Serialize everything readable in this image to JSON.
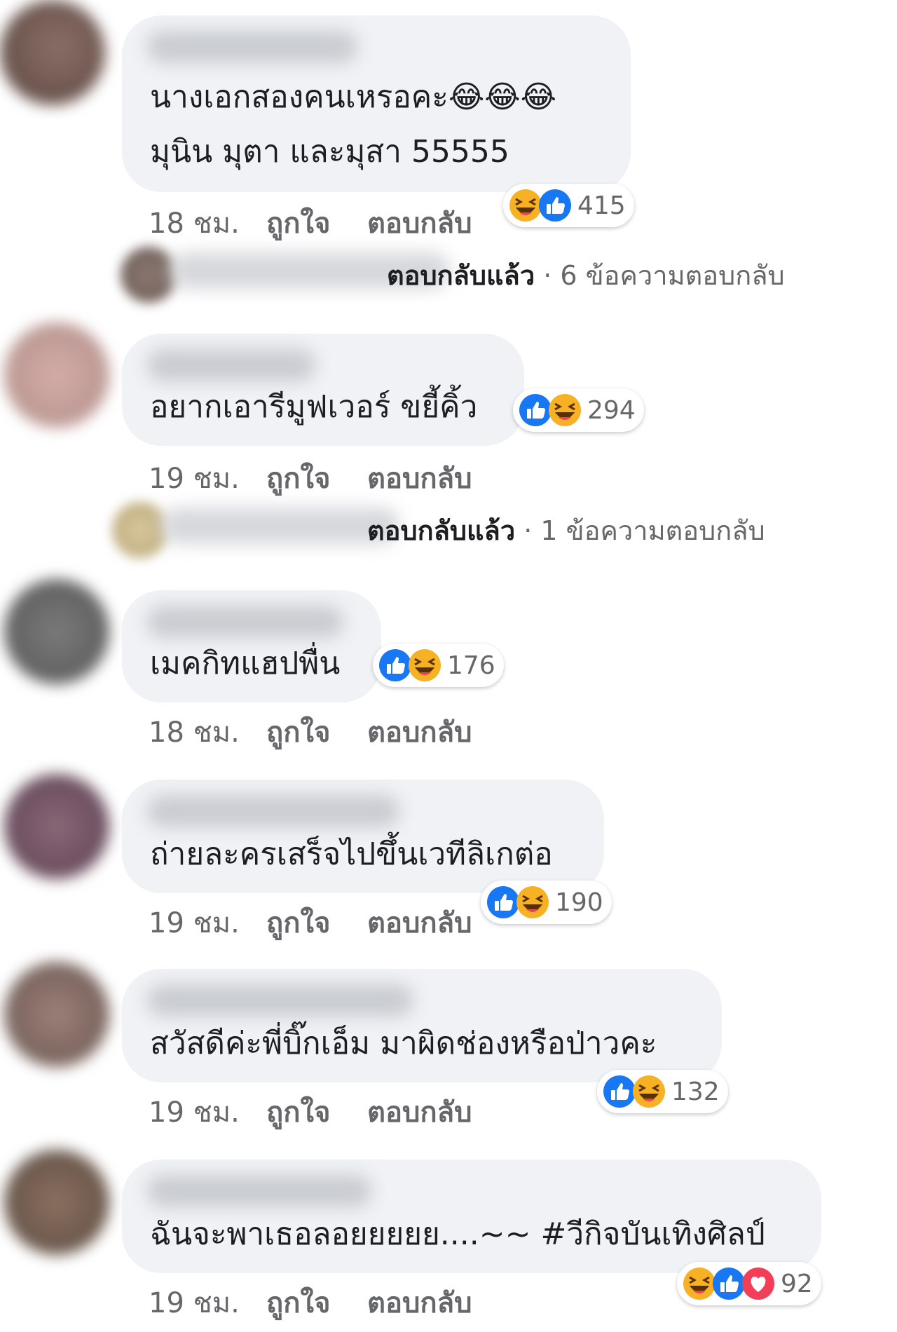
{
  "colors": {
    "bubble": "#f0f2f5",
    "meta_text": "#65676b",
    "like_blue": "#1877f2",
    "haha_yellow": "#f7b125",
    "love_red": "#f33e58"
  },
  "comments": [
    {
      "text_lines": [
        "นางเอกสองคนเหรอคะ😂😂😂",
        "มุนิน มุตา และมุสา 55555"
      ],
      "time": "18 ชม.",
      "like_label": "ถูกใจ",
      "reply_label": "ตอบกลับ",
      "reactions": [
        "haha-icon",
        "like-icon"
      ],
      "reaction_count": "415",
      "replies_summary": {
        "replied": "ตอบกลับแล้ว",
        "count_text": "6 ข้อความตอบกลับ"
      }
    },
    {
      "text_lines": [
        "อยากเอารีมูฟเวอร์ ขยี้คิ้ว"
      ],
      "time": "19 ชม.",
      "like_label": "ถูกใจ",
      "reply_label": "ตอบกลับ",
      "reactions": [
        "like-icon",
        "haha-icon"
      ],
      "reaction_count": "294",
      "replies_summary": {
        "replied": "ตอบกลับแล้ว",
        "count_text": "1 ข้อความตอบกลับ"
      }
    },
    {
      "text_lines": [
        "เมคกิทแฮปพื่น"
      ],
      "time": "18 ชม.",
      "like_label": "ถูกใจ",
      "reply_label": "ตอบกลับ",
      "reactions": [
        "like-icon",
        "haha-icon"
      ],
      "reaction_count": "176"
    },
    {
      "text_lines": [
        "ถ่ายละครเสร็จไปขึ้นเวทีลิเกต่อ"
      ],
      "time": "19 ชม.",
      "like_label": "ถูกใจ",
      "reply_label": "ตอบกลับ",
      "reactions": [
        "like-icon",
        "haha-icon"
      ],
      "reaction_count": "190"
    },
    {
      "text_lines": [
        "สวัสดีค่ะพี่บิ๊กเอ็ม มาผิดช่องหรือป่าวคะ"
      ],
      "time": "19 ชม.",
      "like_label": "ถูกใจ",
      "reply_label": "ตอบกลับ",
      "reactions": [
        "like-icon",
        "haha-icon"
      ],
      "reaction_count": "132"
    },
    {
      "text_lines": [
        "ฉันจะพาเธอลอยยยยย....~~ #วีกิจบันเทิงศิลป์"
      ],
      "time": "19 ชม.",
      "like_label": "ถูกใจ",
      "reply_label": "ตอบกลับ",
      "reactions": [
        "haha-icon",
        "like-icon",
        "love-icon"
      ],
      "reaction_count": "92"
    }
  ]
}
